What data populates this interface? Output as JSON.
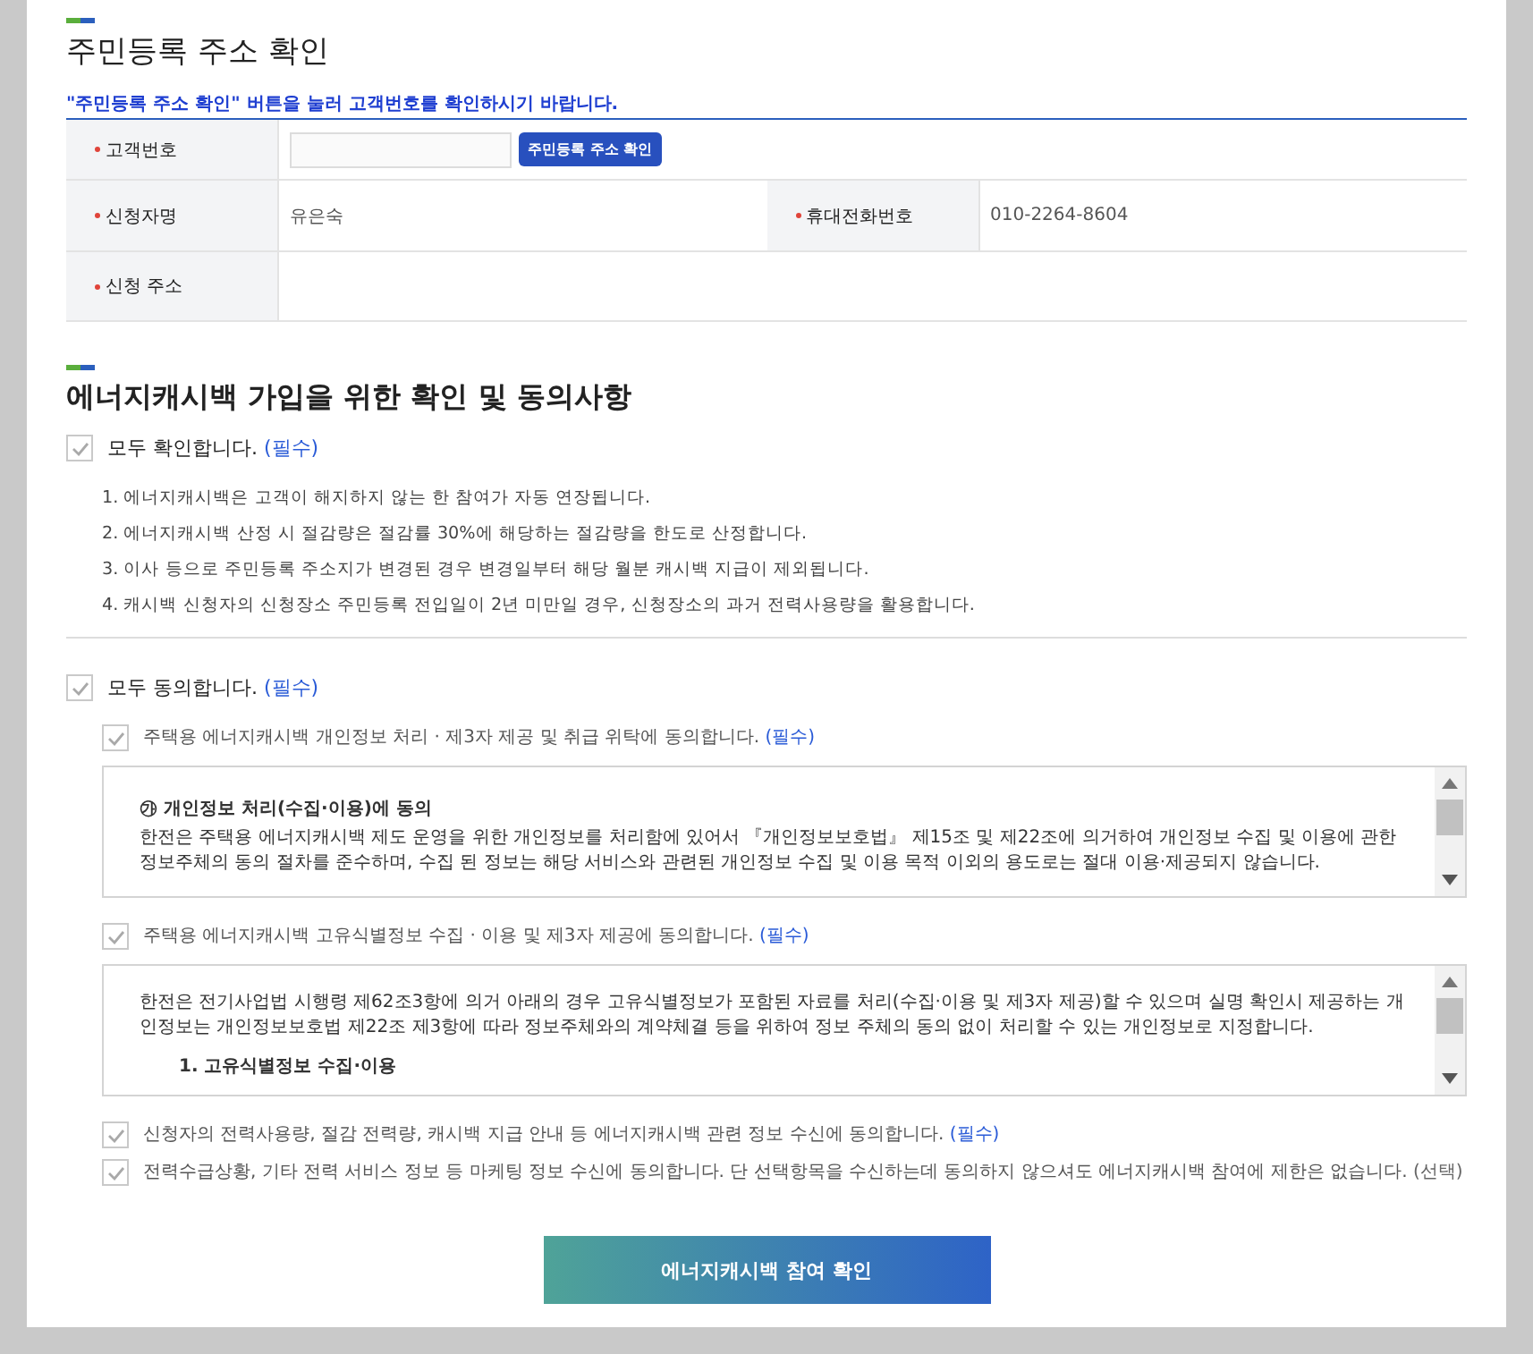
{
  "address_check": {
    "title": "주민등록 주소 확인",
    "notice": "\"주민등록 주소 확인\" 버튼을 눌러 고객번호를 확인하시기 바랍니다.",
    "rows": [
      {
        "cells": [
          {
            "label": "고객번호",
            "required": true,
            "kind": "input",
            "button": "주민등록 주소 확인"
          }
        ]
      },
      {
        "cells": [
          {
            "label": "신청자명",
            "required": true,
            "kind": "text",
            "value": "유은숙"
          },
          {
            "label": "휴대전화번호",
            "required": true,
            "kind": "text",
            "value": "010-2264-8604"
          }
        ]
      },
      {
        "cells": [
          {
            "label": "신청 주소",
            "required": true,
            "kind": "text"
          }
        ]
      }
    ]
  },
  "consent": {
    "title": "에너지캐시백 가입을 위한 확인 및 동의사항",
    "confirm_all": {
      "label": "모두 확인합니다.",
      "tag": "(필수)",
      "tag_required": true,
      "checked": true
    },
    "notes": [
      "1. 에너지캐시백은 고객이 해지하지 않는 한 참여가 자동 연장됩니다.",
      "2. 에너지캐시백 산정 시 절감량은 절감률 30%에 해당하는 절감량을 한도로 산정합니다.",
      "3. 이사 등으로 주민등록 주소지가 변경된 경우 변경일부터 해당 월분 캐시백 지급이 제외됩니다.",
      "4. 캐시백 신청자의 신청장소 주민등록 전입일이 2년 미만일 경우, 신청장소의 과거 전력사용량을 활용합니다."
    ],
    "agree_all": {
      "label": "모두 동의합니다.",
      "tag": "(필수)",
      "tag_required": true,
      "checked": true
    },
    "items": [
      {
        "label": "주택용 에너지캐시백 개인정보 처리 · 제3자 제공 및 취급 위탁에 동의합니다.",
        "tag": "(필수)",
        "tag_required": true,
        "checked": true,
        "box": [
          {
            "kind": "heading",
            "text": "㉮ 개인정보 처리(수집·이용)에 동의"
          },
          {
            "kind": "text",
            "text": "한전은 주택용 에너지캐시백 제도 운영을 위한 개인정보를 처리함에 있어서 『개인정보보호법』 제15조 및 제22조에 의거하여 개인정보 수집 및 이용에 관한 정보주체의 동의 절차를 준수하며, 수집 된 정보는 해당 서비스와 관련된 개인정보 수집 및 이용 목적 이외의 용도로는 절대 이용·제공되지 않습니다."
          }
        ]
      },
      {
        "label": "주택용 에너지캐시백 고유식별정보 수집 · 이용 및 제3자 제공에 동의합니다.",
        "tag": "(필수)",
        "tag_required": true,
        "checked": true,
        "box": [
          {
            "kind": "text",
            "text": "한전은 전기사업법 시행령 제62조3항에 의거 아래의 경우 고유식별정보가 포함된 자료를 처리(수집·이용 및 제3자 제공)할 수 있으며 실명 확인시 제공하는 개인정보는 개인정보보호법 제22조 제3항에 따라 정보주체와의 계약체결 등을 위하여 정보 주체의 동의 없이 처리할 수 있는 개인정보로 지정합니다."
          },
          {
            "kind": "subheading",
            "text": "1. 고유식별정보 수집·이용"
          }
        ]
      },
      {
        "label": "신청자의 전력사용량, 절감 전력량, 캐시백 지급 안내 등 에너지캐시백 관련 정보 수신에 동의합니다.",
        "tag": "(필수)",
        "tag_required": true,
        "checked": true
      },
      {
        "label": "전력수급상황, 기타 전력 서비스 정보 등 마케팅 정보 수신에 동의합니다. 단 선택항목을 수신하는데 동의하지 않으셔도 에너지캐시백 참여에 제한은 없습니다.",
        "tag": "(선택)",
        "tag_required": false,
        "checked": true
      }
    ],
    "submit": "에너지캐시백 참여 확인"
  }
}
